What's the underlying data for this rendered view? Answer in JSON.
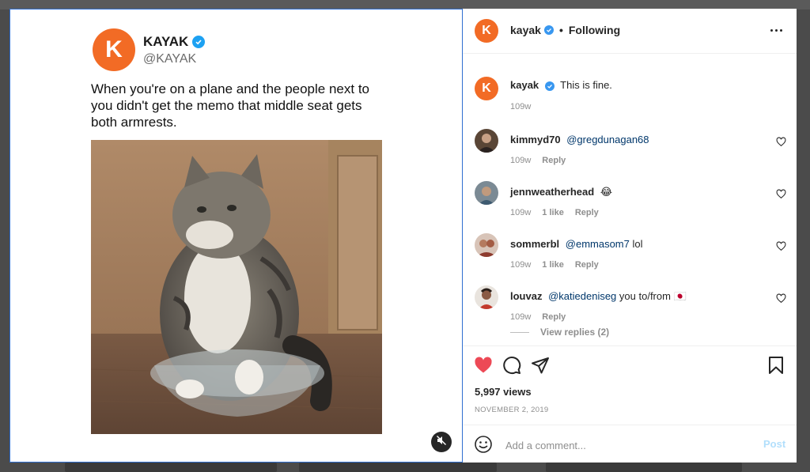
{
  "tweet": {
    "avatar_letter": "K",
    "name": "KAYAK",
    "handle": "@KAYAK",
    "text": "When you're on a plane and the people next to you didn't get the memo that middle seat gets both armrests.",
    "media_icon": "mute-icon"
  },
  "post": {
    "avatar_letter": "K",
    "username": "kayak",
    "separator": "•",
    "follow_state": "Following",
    "more_icon": "more-options-icon",
    "caption": {
      "username": "kayak",
      "text": "This is fine.",
      "time": "109w"
    }
  },
  "comments": [
    {
      "username": "kimmyd70",
      "mention": "@gregdunagan68",
      "text": "",
      "time": "109w",
      "likes": "",
      "reply": "Reply"
    },
    {
      "username": "jennweatherhead",
      "mention": "",
      "text": "😂",
      "time": "109w",
      "likes": "1 like",
      "reply": "Reply"
    },
    {
      "username": "sommerbl",
      "mention": "@emmasom7",
      "text": "lol",
      "time": "109w",
      "likes": "1 like",
      "reply": "Reply"
    },
    {
      "username": "louvaz",
      "mention": "@katiedeniseg",
      "text": "you to/from 🇯🇵",
      "time": "109w",
      "likes": "",
      "reply": "Reply"
    }
  ],
  "view_replies": "View replies (2)",
  "actions": {
    "views": "5,997 views",
    "date": "NOVEMBER 2, 2019",
    "icons": [
      "heart-icon",
      "comment-icon",
      "share-icon",
      "bookmark-icon"
    ],
    "like_color": "#ed4956"
  },
  "comment_box": {
    "placeholder": "Add a comment...",
    "post_label": "Post",
    "emoji_icon": "emoji-icon"
  },
  "colors": {
    "brand": "#f26b25",
    "verified": "#3897f0",
    "mention": "#00376b"
  }
}
